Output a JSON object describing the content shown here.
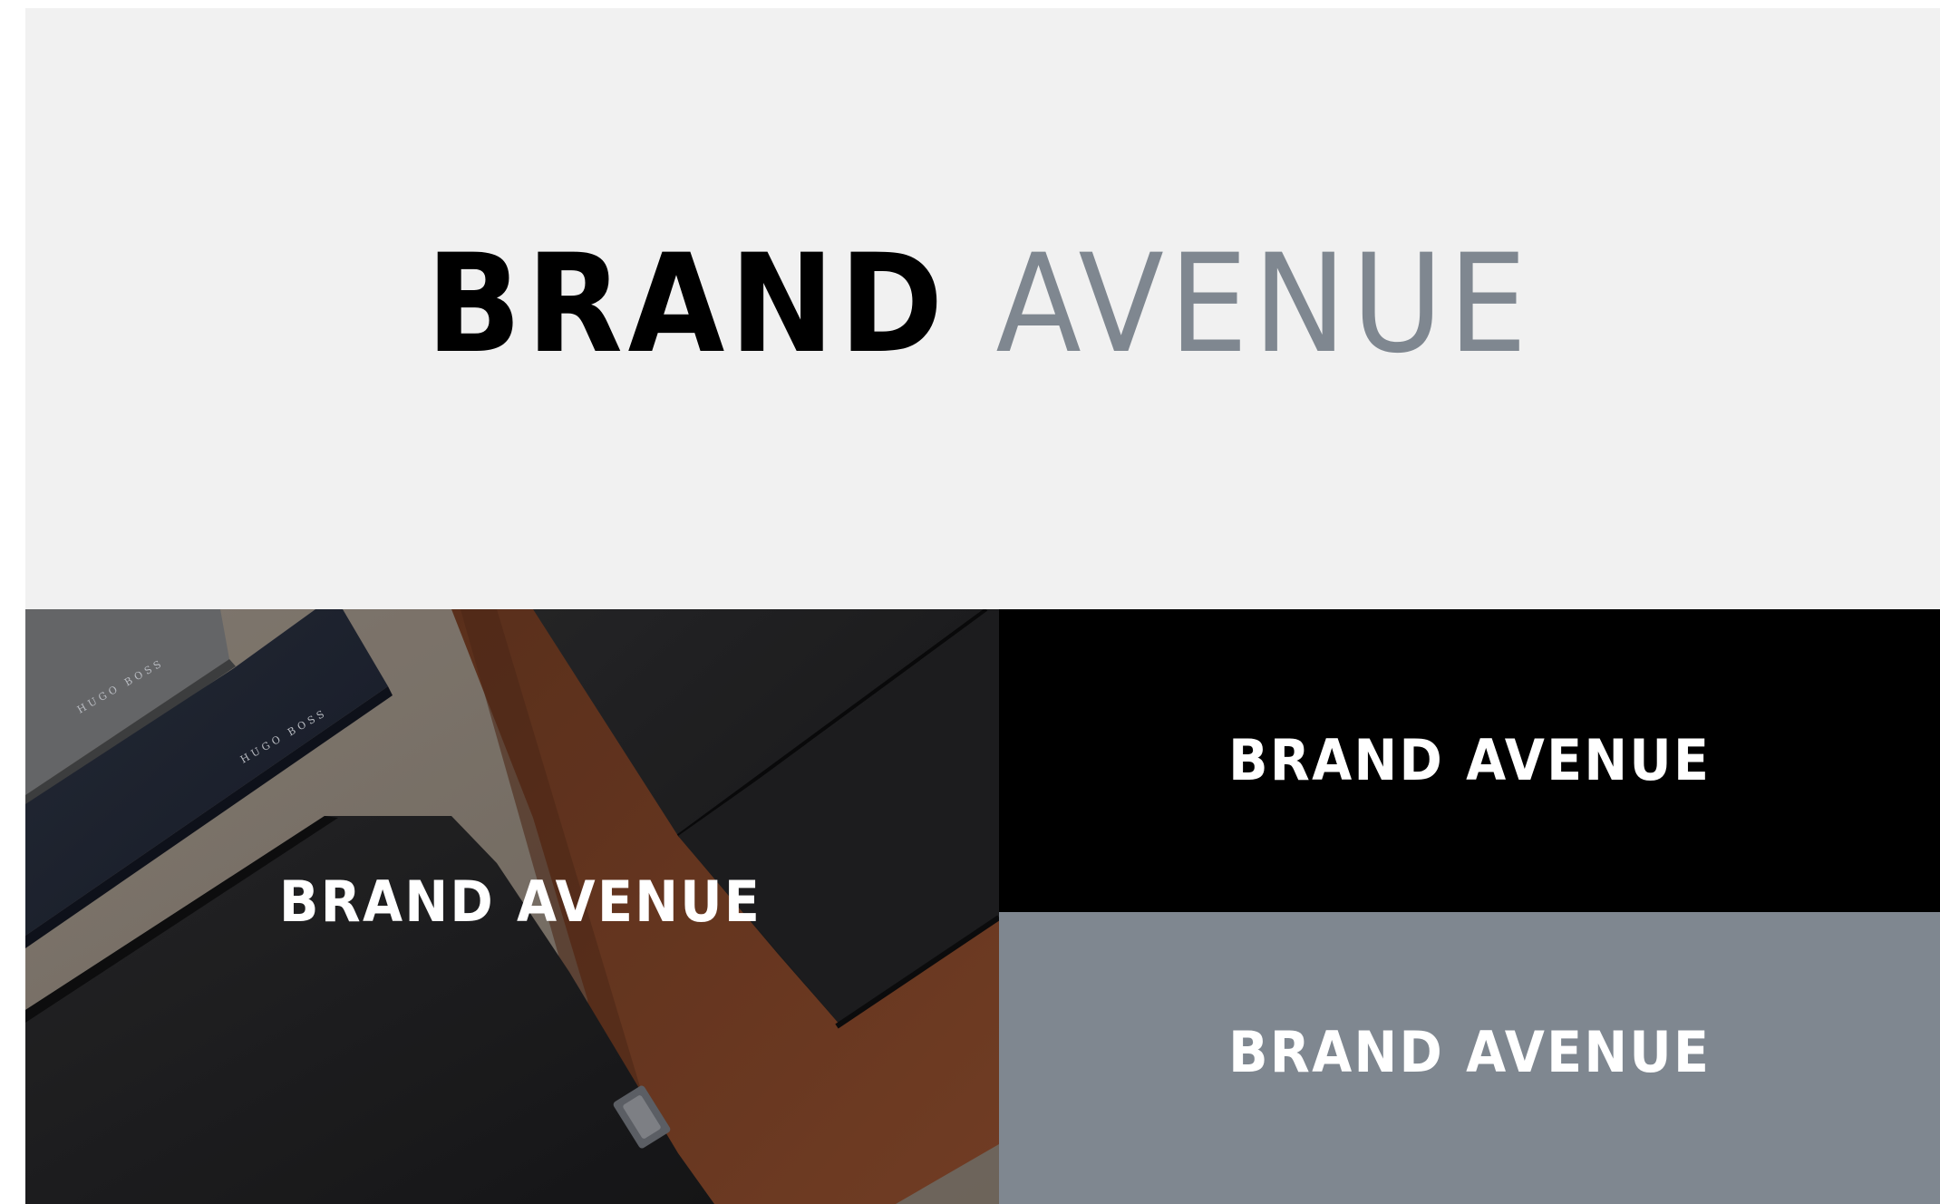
{
  "hero": {
    "logo_word1": "BRAND",
    "logo_word2": "AVENUE"
  },
  "photo_panel": {
    "logo_word1": "BRAND",
    "logo_word2": "AVENUE",
    "embossed_text_1": "HUGO BOSS",
    "embossed_text_2": "HUGO BOSS"
  },
  "black_panel": {
    "logo_word1": "BRAND",
    "logo_word2": "AVENUE"
  },
  "gray_panel": {
    "logo_word1": "BRAND",
    "logo_word2": "AVENUE"
  },
  "colors": {
    "hero_background": "#f1f1f1",
    "logo_dark": "#000000",
    "logo_gray": "#7f8790",
    "black_panel": "#000000",
    "gray_panel": "#7f8790",
    "logo_light": "#ffffff"
  }
}
